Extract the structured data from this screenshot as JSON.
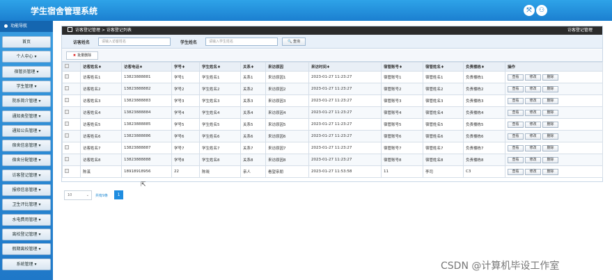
{
  "app": {
    "title": "学生宿舍管理系统"
  },
  "top_icons": [
    "expand-icon",
    "user-icon"
  ],
  "sidebar": {
    "header": "功能导航",
    "items": [
      {
        "label": "首页"
      },
      {
        "label": "个人中心 ▾"
      },
      {
        "label": "宿管员管理 ▾"
      },
      {
        "label": "学生管理 ▾"
      },
      {
        "label": "院系简介管理 ▾"
      },
      {
        "label": "通知类型管理 ▾"
      },
      {
        "label": "通知公告管理 ▾"
      },
      {
        "label": "宿舍信息管理 ▾"
      },
      {
        "label": "宿舍分配管理 ▾"
      },
      {
        "label": "访客登记管理 ▾"
      },
      {
        "label": "报修信息管理 ▾"
      },
      {
        "label": "卫生评比管理 ▾"
      },
      {
        "label": "水电费用管理 ▾"
      },
      {
        "label": "离校登记管理 ▾"
      },
      {
        "label": "假期离校管理 ▾"
      },
      {
        "label": "系统管理 ▾"
      }
    ]
  },
  "breadcrumb": "访客登记管理 > 访客登记列表",
  "panel_right_title": "访客登记管理",
  "search": {
    "visitor_label": "访客姓名",
    "visitor_placeholder": "请输入访客姓名",
    "student_label": "学生姓名",
    "student_placeholder": "请输入学生姓名",
    "query_label": "🔍 查询"
  },
  "toolbar": {
    "batch_delete": "批量删除"
  },
  "table": {
    "columns": [
      "",
      "访客姓名♦",
      "访客电话♦",
      "学号♦",
      "学生姓名♦",
      "关系♦",
      "来访原因",
      "来访时间♦",
      "宿管账号♦",
      "宿管姓名♦",
      "负责楼栋♦",
      "操作"
    ],
    "rows": [
      [
        "访客姓名1",
        "13823888881",
        "学号1",
        "学生姓名1",
        "关系1",
        "来访原因1",
        "2023-01-27 11:23:27",
        "宿管账号1",
        "宿管姓名1",
        "负责楼栋1"
      ],
      [
        "访客姓名2",
        "13823888882",
        "学号2",
        "学生姓名2",
        "关系2",
        "来访原因2",
        "2023-01-27 11:23:27",
        "宿管账号2",
        "宿管姓名2",
        "负责楼栋2"
      ],
      [
        "访客姓名3",
        "13823888883",
        "学号3",
        "学生姓名3",
        "关系3",
        "来访原因3",
        "2023-01-27 11:23:27",
        "宿管账号3",
        "宿管姓名3",
        "负责楼栋3"
      ],
      [
        "访客姓名4",
        "13823888884",
        "学号4",
        "学生姓名4",
        "关系4",
        "来访原因4",
        "2023-01-27 11:23:27",
        "宿管账号4",
        "宿管姓名4",
        "负责楼栋4"
      ],
      [
        "访客姓名5",
        "13823888885",
        "学号5",
        "学生姓名5",
        "关系5",
        "来访原因5",
        "2023-01-27 11:23:27",
        "宿管账号5",
        "宿管姓名5",
        "负责楼栋5"
      ],
      [
        "访客姓名6",
        "13823888886",
        "学号6",
        "学生姓名6",
        "关系6",
        "来访原因6",
        "2023-01-27 11:23:27",
        "宿管账号6",
        "宿管姓名6",
        "负责楼栋6"
      ],
      [
        "访客姓名7",
        "13823888887",
        "学号7",
        "学生姓名7",
        "关系7",
        "来访原因7",
        "2023-01-27 11:23:27",
        "宿管账号7",
        "宿管姓名7",
        "负责楼栋7"
      ],
      [
        "访客姓名8",
        "13823888888",
        "学号8",
        "学生姓名8",
        "关系8",
        "来访原因8",
        "2023-01-27 11:23:27",
        "宿管账号8",
        "宿管姓名8",
        "负责楼栋8"
      ],
      [
        "陈溪",
        "18918918956",
        "22",
        "陈晓",
        "亲人",
        "看望亲朋",
        "2023-01-27 11:53:58",
        "11",
        "李司",
        "C3"
      ]
    ],
    "actions": [
      "查看",
      "修改",
      "删除"
    ]
  },
  "pager": {
    "page_size": "10",
    "total": "共有9条",
    "current_page": "1"
  },
  "watermark": "CSDN @计算机毕设工作室",
  "colors": {
    "brand": "#1b7fd0",
    "accent": "#1f8de0"
  }
}
